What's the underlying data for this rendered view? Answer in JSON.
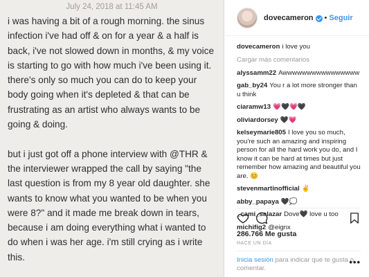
{
  "note": {
    "date": "July 24, 2018 at 11:45 AM",
    "paragraph1": "i was having a bit of a rough morning. the sinus infection i've had off & on for a year & a half is back, i've not slowed down in months, & my voice is starting to go with how much i've been using it. there's only so much you can do to keep your body going when it's depleted & that can be frustrating as an artist who always wants to be going & doing.",
    "paragraph2": "but i just got off a phone interview with @THR & the interviewer wrapped the call by saying \"the last question is from my 8 year old daughter. she wants to know what you wanted to be when you were 8?\" and it made me break down in tears, because i am doing everything what i wanted to do when i was her age. i'm still crying as i write this."
  },
  "post": {
    "username": "dovecameron",
    "separator": "•",
    "follow_label": "Seguir",
    "caption_user": "dovecameron",
    "caption_text": "i love you",
    "load_more": "Cargar más comentarios",
    "comments": [
      {
        "user": "alyssamm22",
        "text": "Awwwwwwwwwwwwwwww"
      },
      {
        "user": "gab_by24",
        "text": "You r a lot more stronger than u think"
      },
      {
        "user": "ciaramw13",
        "text": "💗🖤💗🖤"
      },
      {
        "user": "oliviardorsey",
        "text": "🖤💗"
      },
      {
        "user": "kelseymarie805",
        "text": "I love you so much, you're such an amazing and inspiring person for all the hard work you do, and I know it can be hard at times but just remember how amazing and beautiful you are. 😊"
      },
      {
        "user": "stevenmartinofficial",
        "text": "✌"
      },
      {
        "user": "abby_papaya",
        "text": "🖤💭"
      },
      {
        "user": "_cami_salazar",
        "text": "Dove🖤 love u too"
      },
      {
        "user": "michifig2",
        "text": "@eignx"
      }
    ],
    "likes": "286.766 Me gusta",
    "time": "HACE UN DÍA",
    "login_link": "Inicia sesión",
    "login_text": " para indicar que te gusta o comentar.",
    "options": "•••",
    "colors": {
      "accent": "#3897f0",
      "muted": "#999999",
      "note_bg": "#efedea"
    }
  }
}
